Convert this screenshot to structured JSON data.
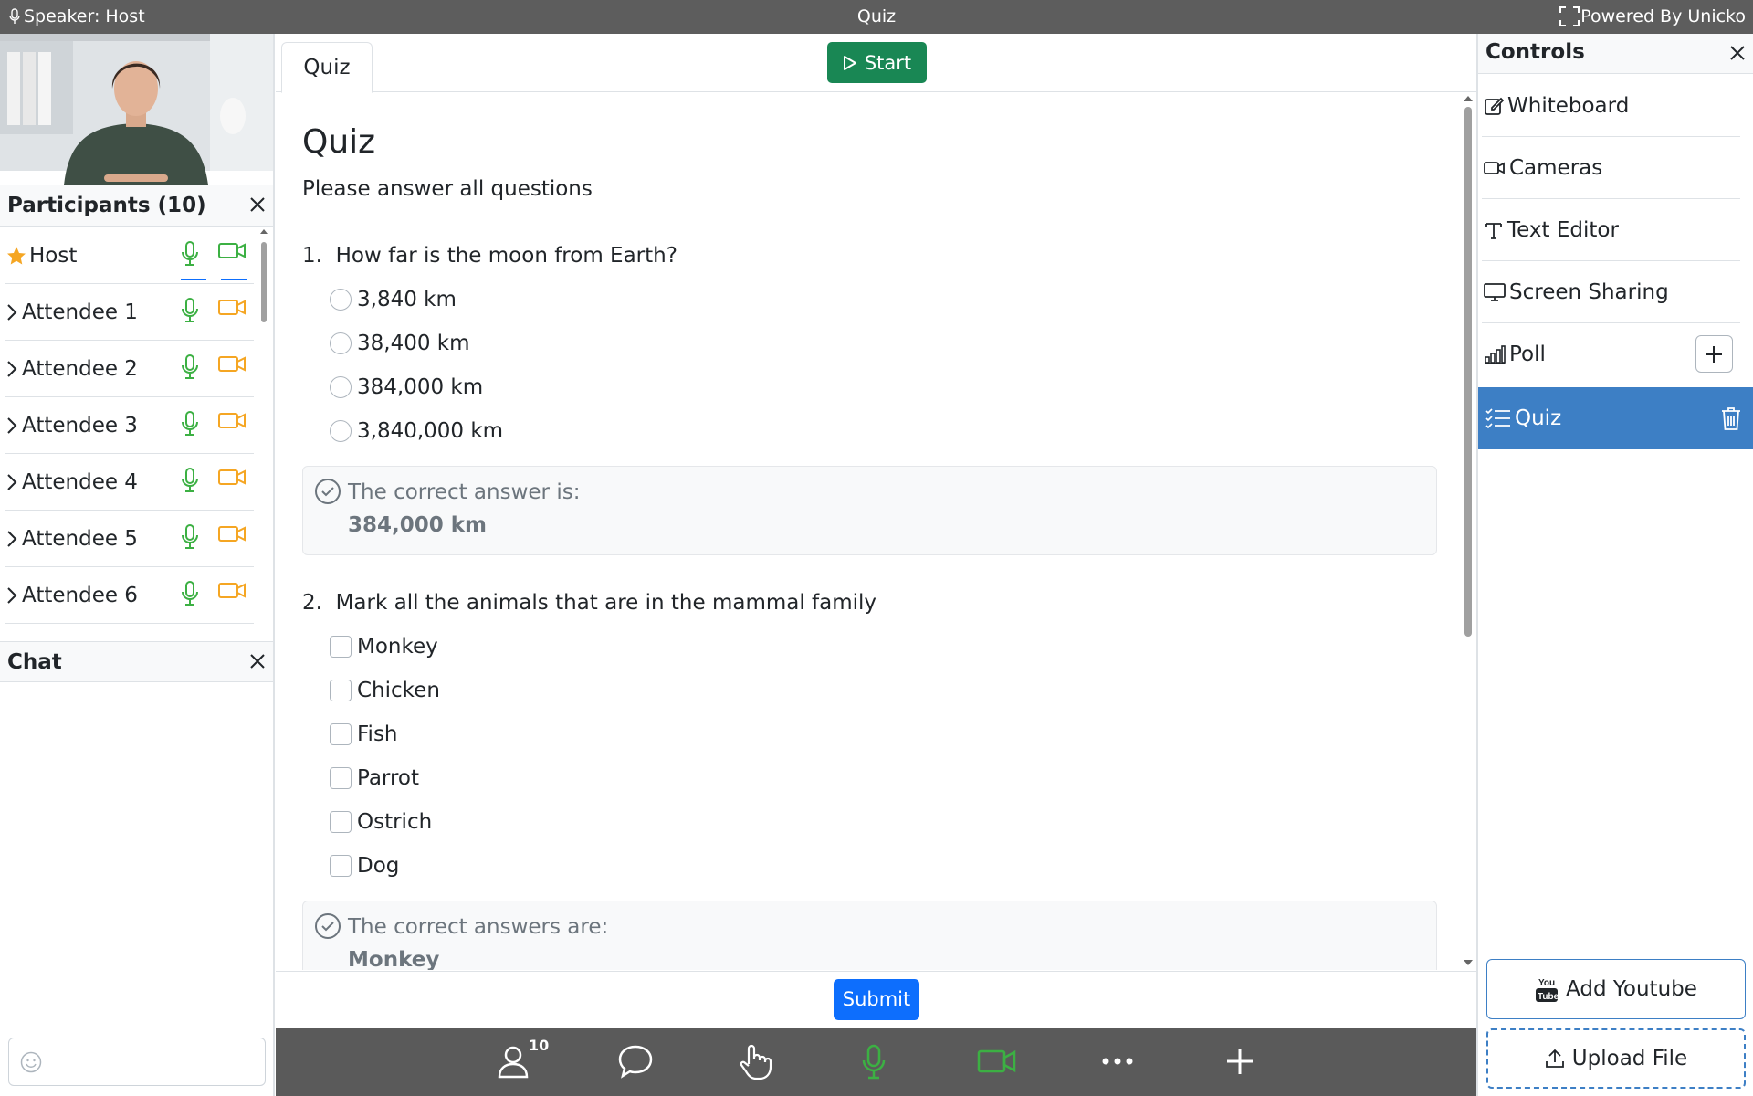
{
  "topbar": {
    "speaker": "Speaker: Host",
    "title": "Quiz",
    "powered_by": "Powered By Unicko"
  },
  "participants": {
    "title": "Participants (10)",
    "items": [
      {
        "name": "Host",
        "role": "host"
      },
      {
        "name": "Attendee 1"
      },
      {
        "name": "Attendee 2"
      },
      {
        "name": "Attendee 3"
      },
      {
        "name": "Attendee 4"
      },
      {
        "name": "Attendee 5"
      },
      {
        "name": "Attendee 6"
      }
    ]
  },
  "chat": {
    "title": "Chat",
    "input_placeholder": ""
  },
  "tabs": [
    {
      "label": "Quiz",
      "active": true
    }
  ],
  "start_button": "Start",
  "quiz": {
    "title": "Quiz",
    "subtitle": "Please answer all questions",
    "questions": [
      {
        "number": "1.",
        "text": "How far is the moon from Earth?",
        "type": "single",
        "options": [
          "3,840 km",
          "38,400 km",
          "384,000 km",
          "3,840,000 km"
        ],
        "answer_label": "The correct answer is:",
        "answer_value": "384,000 km"
      },
      {
        "number": "2.",
        "text": "Mark all the animals that are in the mammal family",
        "type": "multiple",
        "options": [
          "Monkey",
          "Chicken",
          "Fish",
          "Parrot",
          "Ostrich",
          "Dog"
        ],
        "answer_label": "The correct answers are:",
        "answer_value": "Monkey"
      }
    ]
  },
  "submit_button": "Submit",
  "toolbar": {
    "participants_count": "10",
    "icons": [
      "participants-icon",
      "chat-icon",
      "raise-hand-icon",
      "microphone-icon",
      "camera-icon",
      "more-icon",
      "plus-icon"
    ]
  },
  "controls": {
    "title": "Controls",
    "items": [
      {
        "label": "Whiteboard",
        "icon": "pencil-square-icon"
      },
      {
        "label": "Cameras",
        "icon": "camera-icon"
      },
      {
        "label": "Text Editor",
        "icon": "text-icon"
      },
      {
        "label": "Screen Sharing",
        "icon": "monitor-icon"
      },
      {
        "label": "Poll",
        "icon": "bar-chart-icon"
      },
      {
        "label": "Quiz",
        "icon": "checklist-icon",
        "active": true
      }
    ],
    "add_youtube": "Add Youtube",
    "upload_file": "Upload File"
  },
  "colors": {
    "topbar": "#5d5d5d",
    "accent_blue": "#3d7fc5",
    "start_green": "#198754",
    "submit_blue": "#0d6efd",
    "mic_green": "#3cb043",
    "cam_orange": "#f5a623",
    "host_star": "#f5a623"
  }
}
